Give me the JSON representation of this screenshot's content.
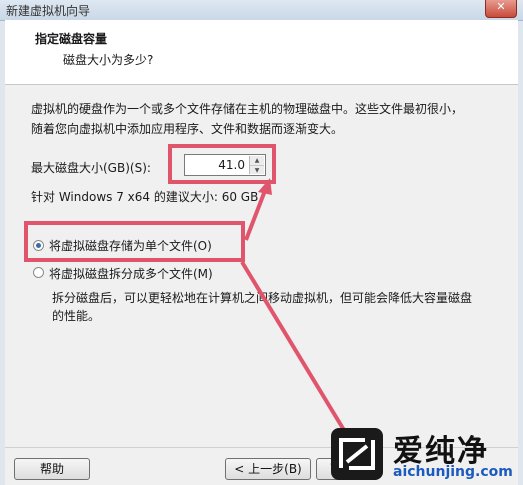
{
  "window": {
    "title": "新建虚拟机向导",
    "close_glyph": "✕"
  },
  "header": {
    "title": "指定磁盘容量",
    "subtitle": "磁盘大小为多少?"
  },
  "content": {
    "description": "虚拟机的硬盘作为一个或多个文件存储在主机的物理磁盘中。这些文件最初很小，随着您向虚拟机中添加应用程序、文件和数据而逐渐变大。",
    "max_size_label": "最大磁盘大小(GB)(S):",
    "max_size_value": "41.0",
    "recommend_text": "针对 Windows 7 x64 的建议大小: 60 GB",
    "option_single": "将虚拟磁盘存储为单个文件(O)",
    "option_split": "将虚拟磁盘拆分成多个文件(M)",
    "split_hint": "拆分磁盘后，可以更轻松地在计算机之间移动虚拟机，但可能会降低大容量磁盘的性能。",
    "selected_option": "single"
  },
  "footer": {
    "help_label": "帮助",
    "back_label": "< 上一步(B)",
    "next_label": "下"
  },
  "watermark": {
    "brand": "爱纯净",
    "url": "aichunjing.com"
  },
  "colors": {
    "annotation": "#e0556c",
    "watermark_url": "#1b5bbf"
  },
  "icons": {
    "spin_up": "▲",
    "spin_down": "▼",
    "logo": "watermark-logo-icon"
  }
}
